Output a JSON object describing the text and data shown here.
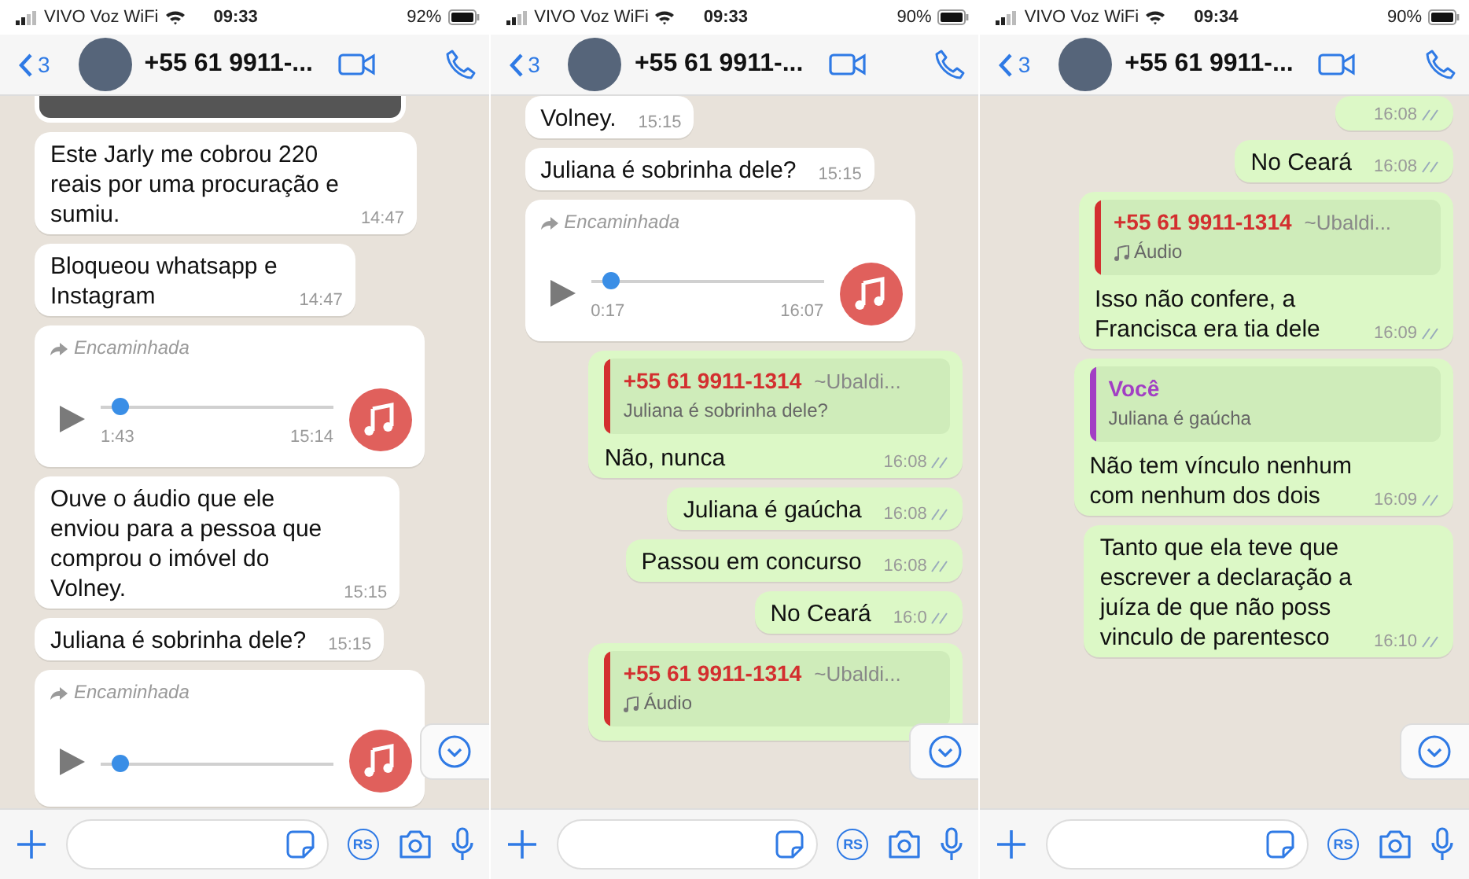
{
  "screens": [
    {
      "status_bar": {
        "carrier": "VIVO Voz WiFi",
        "time": "09:33",
        "battery": "92%"
      },
      "header": {
        "back_count": "3",
        "title": "+55 61 9911-..."
      },
      "messages": [
        {
          "kind": "photo",
          "outgoing": false
        },
        {
          "kind": "text",
          "outgoing": false,
          "text": "Este Jarly me cobrou 220\nreais por uma procuração e\nsumiu.",
          "time": "14:47"
        },
        {
          "kind": "text",
          "outgoing": false,
          "text": "Bloqueou whatsapp e\nInstagram",
          "time": "14:47"
        },
        {
          "kind": "audio",
          "outgoing": false,
          "forwarded": "Encaminhada",
          "audio": {
            "duration": "1:43",
            "level": 0.05
          },
          "time": "15:14"
        },
        {
          "kind": "text",
          "outgoing": false,
          "text": "Ouve o áudio que ele\nenviou para a pessoa que\ncomprou o imóvel do\nVolney.",
          "time": "15:15"
        },
        {
          "kind": "text",
          "outgoing": false,
          "text": "Juliana é sobrinha dele?",
          "time": "15:15"
        },
        {
          "kind": "audio",
          "outgoing": false,
          "forwarded": "Encaminhada",
          "audio": {
            "level": 0.05
          }
        }
      ],
      "input_bar": {
        "badge": "RS"
      }
    },
    {
      "status_bar": {
        "carrier": "VIVO Voz WiFi",
        "time": "09:33",
        "battery": "90%"
      },
      "header": {
        "back_count": "3",
        "title": "+55 61 9911-..."
      },
      "messages": [
        {
          "kind": "text",
          "outgoing": false,
          "text": "Volney.",
          "time": "15:15"
        },
        {
          "kind": "text",
          "outgoing": false,
          "text": "Juliana é sobrinha dele?",
          "time": "15:15"
        },
        {
          "kind": "audio",
          "outgoing": false,
          "forwarded": "Encaminhada",
          "audio": {
            "duration": "0:17",
            "level": 0.05
          },
          "time": "16:07"
        },
        {
          "kind": "text",
          "outgoing": true,
          "quote": {
            "author": "+55 61 9911-1314",
            "alias": "~Ubaldi...",
            "color": "#d32f2f",
            "kind": "text",
            "text": "Juliana é sobrinha dele?"
          },
          "text": "Não, nunca",
          "time": "16:08"
        },
        {
          "kind": "text",
          "outgoing": true,
          "text": "Juliana é gaúcha",
          "time": "16:08"
        },
        {
          "kind": "text",
          "outgoing": true,
          "text": "Passou em concurso",
          "time": "16:08"
        },
        {
          "kind": "text",
          "outgoing": true,
          "text": "No Ceará",
          "time": "16:0"
        },
        {
          "kind": "text",
          "outgoing": true,
          "quote": {
            "author": "+55 61 9911-1314",
            "alias": "~Ubaldi...",
            "color": "#d32f2f",
            "kind": "audio",
            "text": "Áudio"
          }
        }
      ],
      "input_bar": {
        "badge": "RS"
      }
    },
    {
      "status_bar": {
        "carrier": "VIVO Voz WiFi",
        "time": "09:34",
        "battery": "90%"
      },
      "header": {
        "back_count": "3",
        "title": "+55 61 9911-..."
      },
      "messages": [
        {
          "kind": "time_only",
          "outgoing": true,
          "time": "16:08"
        },
        {
          "kind": "text",
          "outgoing": true,
          "text": "No Ceará",
          "time": "16:08"
        },
        {
          "kind": "text",
          "outgoing": true,
          "quote": {
            "author": "+55 61 9911-1314",
            "alias": "~Ubaldi...",
            "color": "#d32f2f",
            "kind": "audio",
            "text": "Áudio"
          },
          "text": "Isso não confere, a\nFrancisca era tia dele",
          "time": "16:09"
        },
        {
          "kind": "text",
          "outgoing": true,
          "quote": {
            "author": "Você",
            "color": "#a23fc4",
            "kind": "text",
            "text": "Juliana é gaúcha"
          },
          "text": "Não tem vínculo nenhum\ncom nenhum dos dois",
          "time": "16:09"
        },
        {
          "kind": "text",
          "outgoing": true,
          "text": "Tanto que ela teve que\nescrever a declaração a\njuíza de que não poss\nvinculo de parentesco",
          "time": "16:10"
        }
      ],
      "input_bar": {
        "badge": "RS"
      }
    }
  ]
}
